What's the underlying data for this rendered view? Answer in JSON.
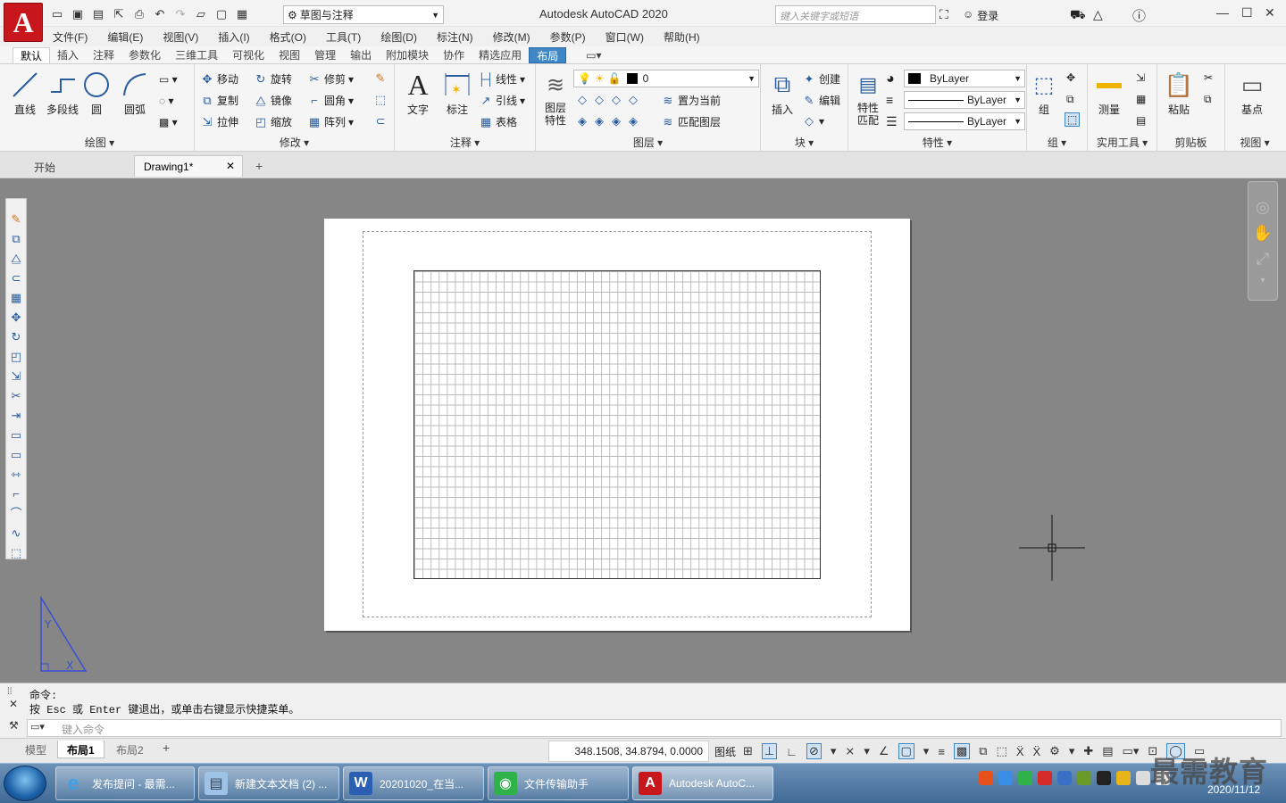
{
  "app": {
    "title": "Autodesk AutoCAD 2020",
    "logo_letter": "A",
    "workspace": "草图与注释",
    "search_placeholder": "键入关键字或短语",
    "login": "登录"
  },
  "menu": [
    "文件(F)",
    "编辑(E)",
    "视图(V)",
    "插入(I)",
    "格式(O)",
    "工具(T)",
    "绘图(D)",
    "标注(N)",
    "修改(M)",
    "参数(P)",
    "窗口(W)",
    "帮助(H)"
  ],
  "ribbon_tabs": [
    "默认",
    "插入",
    "注释",
    "参数化",
    "三维工具",
    "可视化",
    "视图",
    "管理",
    "输出",
    "附加模块",
    "协作",
    "精选应用",
    "布局"
  ],
  "ribbon": {
    "draw": {
      "title": "绘图",
      "line": "直线",
      "polyline": "多段线",
      "circle": "圆",
      "arc": "圆弧"
    },
    "modify": {
      "title": "修改",
      "move": "移动",
      "rotate": "旋转",
      "trim": "修剪",
      "copy": "复制",
      "mirror": "镜像",
      "fillet": "圆角",
      "stretch": "拉伸",
      "scale": "缩放",
      "array": "阵列"
    },
    "annotation": {
      "title": "注释",
      "text": "文字",
      "dimension": "标注",
      "linear": "线性",
      "leader": "引线",
      "table": "表格"
    },
    "layers": {
      "title": "图层",
      "properties": "图层\n特性",
      "current_layer": "0",
      "set_current": "置为当前",
      "match_layer": "匹配图层"
    },
    "block": {
      "title": "块",
      "insert": "插入",
      "create": "创建",
      "edit": "编辑"
    },
    "properties": {
      "title": "特性",
      "match": "特性\n匹配",
      "color": "ByLayer",
      "linetype": "ByLayer",
      "lineweight": "ByLayer"
    },
    "groups": {
      "title": "组",
      "group": "组"
    },
    "utilities": {
      "title": "实用工具",
      "measure": "测量"
    },
    "clipboard": {
      "title": "剪贴板",
      "paste": "粘贴"
    },
    "view": {
      "title": "视图",
      "base": "基点"
    }
  },
  "doc_tabs": {
    "start": "开始",
    "drawing": "Drawing1*"
  },
  "command": {
    "line1": "命令:",
    "line2": "按 Esc 或 Enter 键退出，或单击右键显示快捷菜单。",
    "placeholder": "键入命令"
  },
  "layout_tabs": [
    "模型",
    "布局1",
    "布局2"
  ],
  "status": {
    "coords": "348.1508, 34.8794, 0.0000",
    "paper": "图纸"
  },
  "taskbar": {
    "items": [
      "发布提问 - 最需...",
      "新建文本文档 (2) ...",
      "20201020_在当...",
      "文件传输助手",
      "Autodesk AutoC..."
    ],
    "date": "2020/11/12"
  },
  "watermark": "最需教育",
  "colors": {
    "accent": "#3f86c7",
    "autocad_red": "#c8161d",
    "canvas": "#868686"
  }
}
